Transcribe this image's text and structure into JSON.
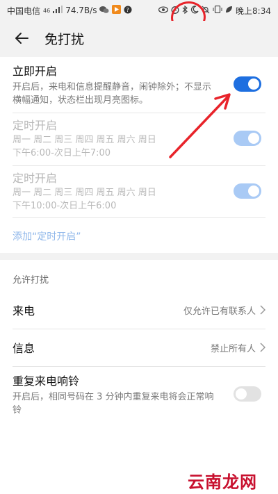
{
  "status_bar": {
    "carrier": "中国电信",
    "network_tag": "46",
    "speed": "74.7B/s",
    "time": "晚上8:34"
  },
  "header": {
    "title": "免打扰"
  },
  "immediate": {
    "title": "立即开启",
    "description": "开启后，来电和信息提醒静音，闹钟除外；不显示横幅通知，状态栏出现月亮图标。",
    "enabled": true
  },
  "schedules": [
    {
      "title": "定时开启",
      "days": "周一 周二 周三 周四 周五 周六 周日",
      "time": "下午6:00-次日上午7:00",
      "enabled": true
    },
    {
      "title": "定时开启",
      "days": "周一 周二 周三 周四 周五 周六 周日",
      "time": "下午10:00-次日上午6:00",
      "enabled": true
    }
  ],
  "add_schedule": "添加“定时开启”",
  "allow_section": {
    "label": "允许打扰",
    "calls": {
      "title": "来电",
      "value": "仅允许已有联系人"
    },
    "messages": {
      "title": "信息",
      "value": "禁止所有人"
    },
    "repeat_call": {
      "title": "重复来电响铃",
      "description": "开启后，相同号码在 3 分钟内重复来电将会正常响铃",
      "enabled": false
    }
  },
  "watermark": "云南龙网",
  "colors": {
    "accent": "#1e6fe0",
    "accent_disabled": "#a9caf5",
    "annotation": "#e8232a"
  },
  "icons": [
    "back-arrow-icon",
    "chevron-right-icon",
    "wifi-icon",
    "signal-icon",
    "eye-icon",
    "alarm-icon",
    "bluetooth-icon",
    "moon-icon",
    "bell-off-icon",
    "vibrate-icon",
    "battery-icon"
  ]
}
